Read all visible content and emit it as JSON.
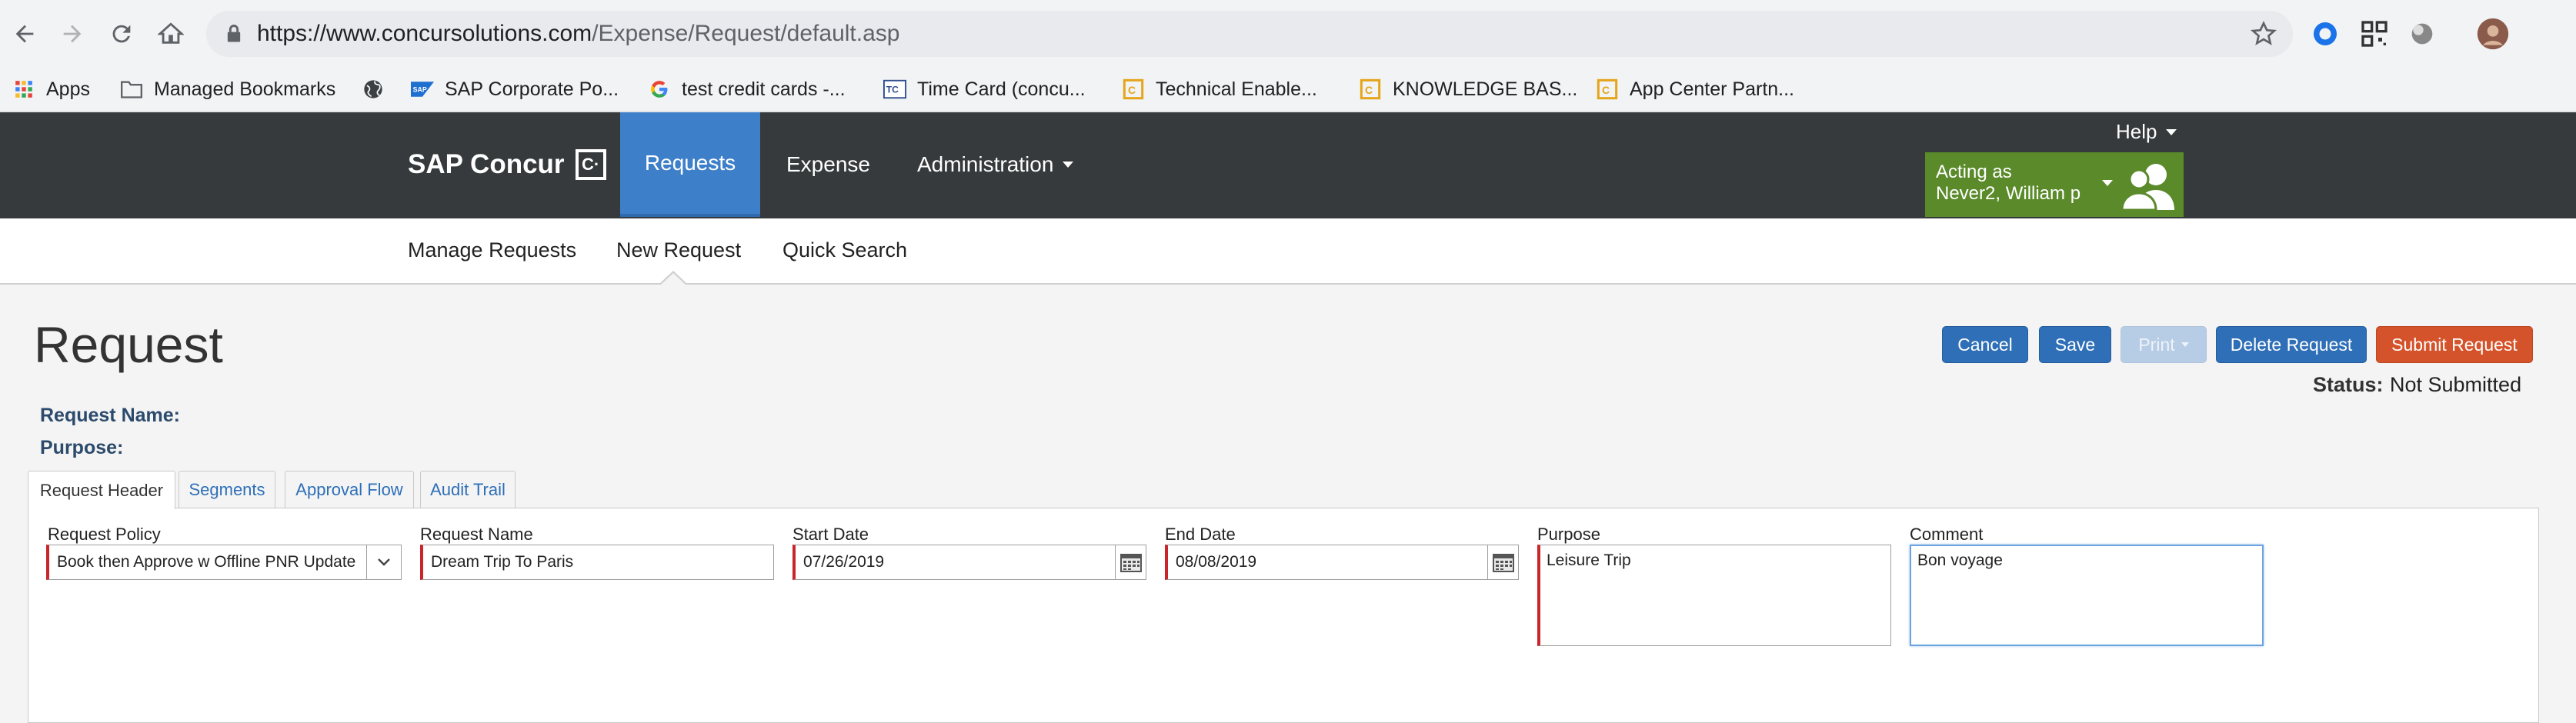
{
  "browser": {
    "url_host": "https://www.concursolutions.com",
    "url_path": "/Expense/Request/default.asp",
    "bookmarks": [
      {
        "label": "Apps",
        "icon": "apps-grid-icon"
      },
      {
        "label": "Managed Bookmarks",
        "icon": "folder-icon"
      },
      {
        "label": "",
        "icon": "globe-icon"
      },
      {
        "label": "SAP Corporate Po...",
        "icon": "sap-logo-icon"
      },
      {
        "label": "test credit cards -...",
        "icon": "google-g-icon"
      },
      {
        "label": "Time Card (concu...",
        "icon": "timecard-icon"
      },
      {
        "label": "Technical Enable...",
        "icon": "concur-icon"
      },
      {
        "label": "KNOWLEDGE BAS...",
        "icon": "concur-icon"
      },
      {
        "label": "App Center Partn...",
        "icon": "concur-icon"
      }
    ]
  },
  "header": {
    "logo_text": "SAP Concur",
    "logo_mark": "C·",
    "nav": [
      {
        "label": "Requests",
        "active": true
      },
      {
        "label": "Expense",
        "active": false
      },
      {
        "label": "Administration",
        "active": false
      }
    ],
    "help_label": "Help",
    "acting_as_label": "Acting as",
    "acting_as_name": "Never2, William p"
  },
  "subnav": {
    "items": [
      "Manage Requests",
      "New Request",
      "Quick Search"
    ],
    "active_index": 1
  },
  "page": {
    "title": "Request",
    "buttons": {
      "cancel": "Cancel",
      "save": "Save",
      "print": "Print",
      "delete": "Delete Request",
      "submit": "Submit Request"
    },
    "status_label": "Status:",
    "status_value": "Not Submitted",
    "request_name_label": "Request Name:",
    "purpose_label": "Purpose:"
  },
  "tabs": [
    "Request Header",
    "Segments",
    "Approval Flow",
    "Audit Trail"
  ],
  "form": {
    "policy": {
      "label": "Request Policy",
      "value": "Book then Approve w Offline PNR Update"
    },
    "request_name": {
      "label": "Request Name",
      "value": "Dream Trip To Paris"
    },
    "start_date": {
      "label": "Start Date",
      "value": "07/26/2019"
    },
    "end_date": {
      "label": "End Date",
      "value": "08/08/2019"
    },
    "purpose": {
      "label": "Purpose",
      "value": "Leisure Trip"
    },
    "comment": {
      "label": "Comment",
      "value": "Bon voyage"
    }
  },
  "colors": {
    "header_bg": "#363a3d",
    "active_nav": "#3e7fc9",
    "acting_as_bg": "#5a8a2a",
    "primary_button": "#2e6fb8",
    "submit_button": "#d5532b",
    "required_marker": "#c9252b"
  }
}
